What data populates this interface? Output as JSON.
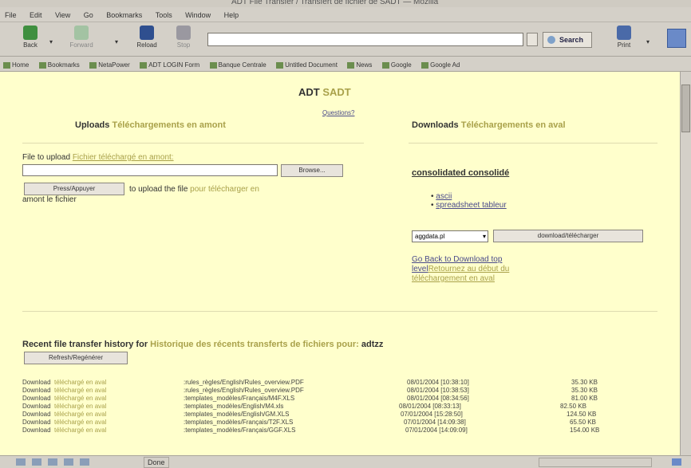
{
  "window": {
    "title": "ADT File Transfer / Transfert de fichier de SADT — Mozilla"
  },
  "menu": [
    "File",
    "Edit",
    "View",
    "Go",
    "Bookmarks",
    "Tools",
    "Window",
    "Help"
  ],
  "nav": {
    "back": "Back",
    "forward": "Forward",
    "reload": "Reload",
    "stop": "Stop",
    "search": "Search",
    "print": "Print",
    "url": ""
  },
  "bookmarks": [
    "Home",
    "Bookmarks",
    "NetaPower",
    "ADT LOGIN Form",
    "Banque Centrale",
    "Untitled Document",
    "News",
    "Google",
    "Google Ad"
  ],
  "page": {
    "title_en": "ADT",
    "title_fr": "SADT",
    "questions": "Questions?",
    "uploads_en": "Uploads",
    "uploads_fr": "Téléchargements en amont",
    "downloads_en": "Downloads",
    "downloads_fr": "Téléchargements en aval",
    "file_label_en": "File to upload",
    "file_label_fr": "Fichier téléchargé en amont:",
    "file_value": "",
    "browse": "Browse...",
    "press": "Press/Appuyer",
    "upload_text_en": "to upload the file",
    "upload_text_fr_a": "pour télécharger en",
    "upload_text_fr_b": "amont le fichier",
    "consolidated": "consolidated consolidé",
    "format_ascii": "ascii",
    "format_spreadsheet": "spreadsheet tableur",
    "select_value": "aggdata.pl",
    "download_btn": "download/télécharger",
    "goback_a": "Go Back to Download top",
    "goback_b": "level",
    "goback_fr_a": "Retournez au début du",
    "goback_fr_b": "téléchargement en aval",
    "history_en": "Recent file transfer history for",
    "history_fr": "Historique des récents transferts de fichiers pour:",
    "history_user": "adtzz",
    "refresh": "Refresh/Regénérer"
  },
  "history": [
    {
      "type_en": "Download",
      "type_fr": "téléchargé en aval",
      "path": ":rules_règles/English/Rules_overview.PDF",
      "date": "08/01/2004 [10:38:10]",
      "size": "35.30 KB"
    },
    {
      "type_en": "Download",
      "type_fr": "téléchargé en aval",
      "path": ":rules_règles/English/Rules_overview.PDF",
      "date": "08/01/2004 [10:38:53]",
      "size": "35.30 KB"
    },
    {
      "type_en": "Download",
      "type_fr": "téléchargé en aval",
      "path": ":templates_modèles/Français/M4F.XLS",
      "date": "08/01/2004 [08:34:56]",
      "size": "81.00 KB"
    },
    {
      "type_en": "Download",
      "type_fr": "téléchargé en aval",
      "path": ":templates_modèles/English/M4.xls",
      "date": "08/01/2004 [08:33:13]",
      "size": "82.50 KB"
    },
    {
      "type_en": "Download",
      "type_fr": "téléchargé en aval",
      "path": ":templates_modèles/English/GM.XLS",
      "date": "07/01/2004 [15:28:50]",
      "size": "124.50 KB"
    },
    {
      "type_en": "Download",
      "type_fr": "téléchargé en aval",
      "path": ":templates_modèles/Français/T2F.XLS",
      "date": "07/01/2004 [14:09:38]",
      "size": "65.50 KB"
    },
    {
      "type_en": "Download",
      "type_fr": "téléchargé en aval",
      "path": ":templates_modèles/Français/GGF.XLS",
      "date": "07/01/2004 [14:09:09]",
      "size": "154.00 KB"
    }
  ],
  "status": {
    "text": "Done"
  }
}
